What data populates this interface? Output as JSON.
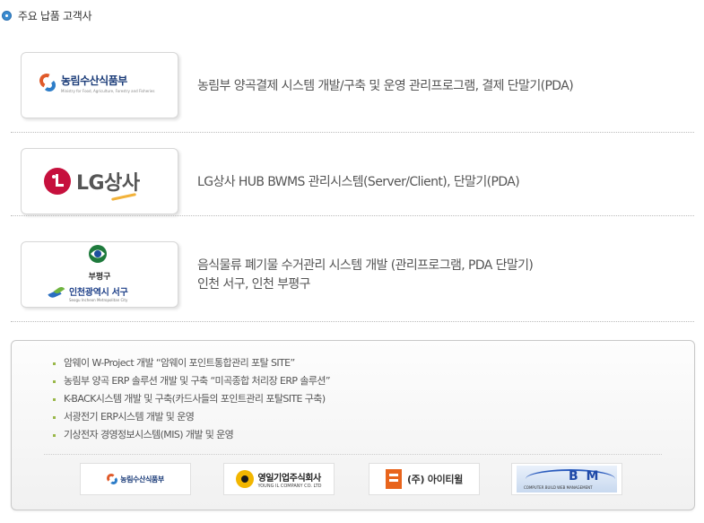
{
  "section_title": "주요 납품 고객사",
  "clients": [
    {
      "logo": "mafra-logo",
      "logo_name_ko": "농림수산식품부",
      "logo_name_en": "Ministry for Food, Agriculture, Forestry and Fisheries",
      "description_lines": [
        "농림부 양곡결제 시스템 개발/구축 및 운영 관리프로그램, 결제 단말기(PDA)"
      ]
    },
    {
      "logo": "lg-logo",
      "logo_name": "LG상사",
      "description_lines": [
        "LG상사 HUB BWMS 관리시스템(Server/Client), 단말기(PDA)"
      ]
    },
    {
      "logo": "incheon-logos",
      "logo_name_bupyeong": "부평구",
      "logo_name_seogu": "인천광역시 서구",
      "logo_name_seogu_en": "Seogu Incheon Metropolitan City",
      "description_lines": [
        "음식물류 폐기물 수거관리 시스템 개발 (관리프로그램, PDA 단말기)",
        "인천 서구, 인천 부평구"
      ]
    }
  ],
  "projects": [
    "암웨이 W-Project 개발  “암웨이 포인트통합관리 포탈 SITE”",
    "농림부 양곡 ERP 솔루션 개발 및 구축  “미곡종합 처리장 ERP 솔루션”",
    "K-BACK시스템 개발 및 구축(카드사들의 포인트관리 포탈SITE 구축)",
    "서광전기 ERP시스템 개발 및 운영",
    "기상전자 경영정보시스템(MIS) 개발 및 운영"
  ],
  "partner_logos": {
    "mafra": "농림수산식품부",
    "youngil_ko": "영일기업주식회사",
    "youngil_en": "YOUNG IL COMPANY CO. LTD",
    "itwill": "(주) 아이티윌",
    "bm": "B M",
    "bm_sub": "COMPUTER BUILD  WEB MANAGEMENT"
  },
  "colors": {
    "bullet": "#3a8bd0",
    "lg_red": "#c6103d",
    "mafra_navy": "#1a3b78",
    "list_bullet": "#9ab84a"
  }
}
